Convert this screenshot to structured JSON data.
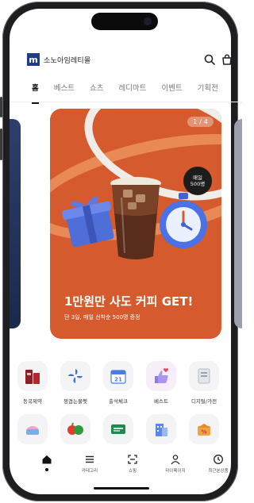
{
  "header": {
    "logo_mark": "m",
    "brand_name": "소노아임레티몰",
    "icons": [
      "search-icon",
      "shopping-bag-icon"
    ]
  },
  "tabs": [
    "홈",
    "베스트",
    "쇼츠",
    "레디마트",
    "이벤트",
    "기획전"
  ],
  "active_tab": 0,
  "banner": {
    "counter_current": "1",
    "counter_total": "4",
    "badge_line1": "매일",
    "badge_line2": "500명",
    "title": "1만원만 사도 커피 GET!",
    "subtitle": "단 3일, 매일 선착순 500명 증정",
    "accent": "#d55a2d"
  },
  "categories": [
    {
      "label": "동국제약",
      "icon": "product-box-icon"
    },
    {
      "label": "쟁겹는물펫",
      "icon": "pinwheel-icon"
    },
    {
      "label": "출석체크",
      "icon": "calendar-icon"
    },
    {
      "label": "베스트",
      "icon": "thumbs-up-heart-icon"
    },
    {
      "label": "디지털/가전",
      "icon": "appliance-icon"
    },
    {
      "label": "",
      "icon": "cake-icon"
    },
    {
      "label": "",
      "icon": "vegetables-icon"
    },
    {
      "label": "",
      "icon": "green-tag-icon"
    },
    {
      "label": "",
      "icon": "building-icon"
    },
    {
      "label": "",
      "icon": "sale-box-icon"
    }
  ],
  "bottom_nav": [
    {
      "label": "",
      "icon": "home-icon",
      "active": true
    },
    {
      "label": "카테고리",
      "icon": "menu-icon"
    },
    {
      "label": "쇼핑",
      "icon": "scan-icon"
    },
    {
      "label": "마이페이지",
      "icon": "person-icon"
    },
    {
      "label": "최근본상품",
      "icon": "clock-icon"
    }
  ]
}
